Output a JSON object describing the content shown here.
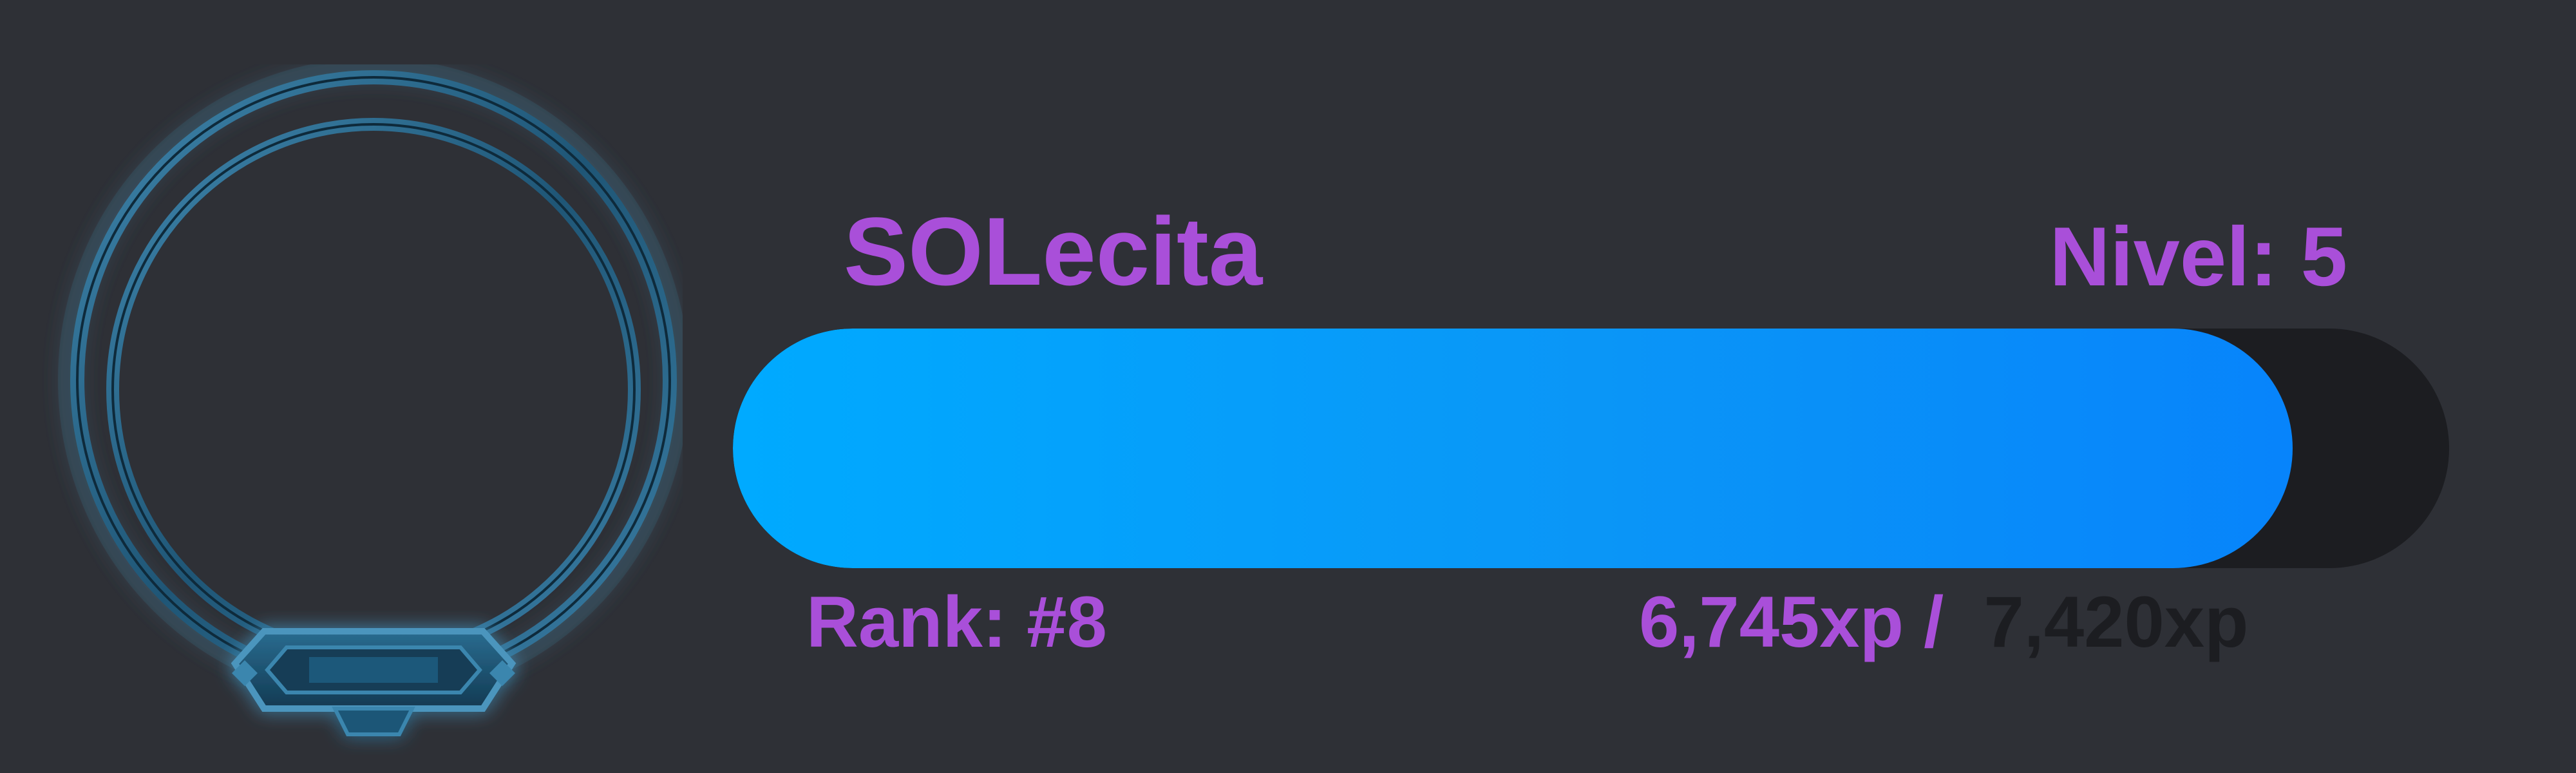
{
  "user": {
    "username": "SOLecita",
    "level_label": "Nivel: 5",
    "rank_label": "Rank: #8"
  },
  "xp": {
    "current_label": "6,745xp",
    "separator": " /  ",
    "needed_label": "7,420xp",
    "progress_fraction": 0.909
  },
  "colors": {
    "background": "#2e3036",
    "accent_text": "#a94fd9",
    "bar_start": "#00aaff",
    "bar_end": "#0784fb",
    "bar_track": "#1c1d21",
    "frame": "#2f6f95"
  },
  "icons": {
    "avatar_frame": "ornate-ring-frame-icon"
  }
}
